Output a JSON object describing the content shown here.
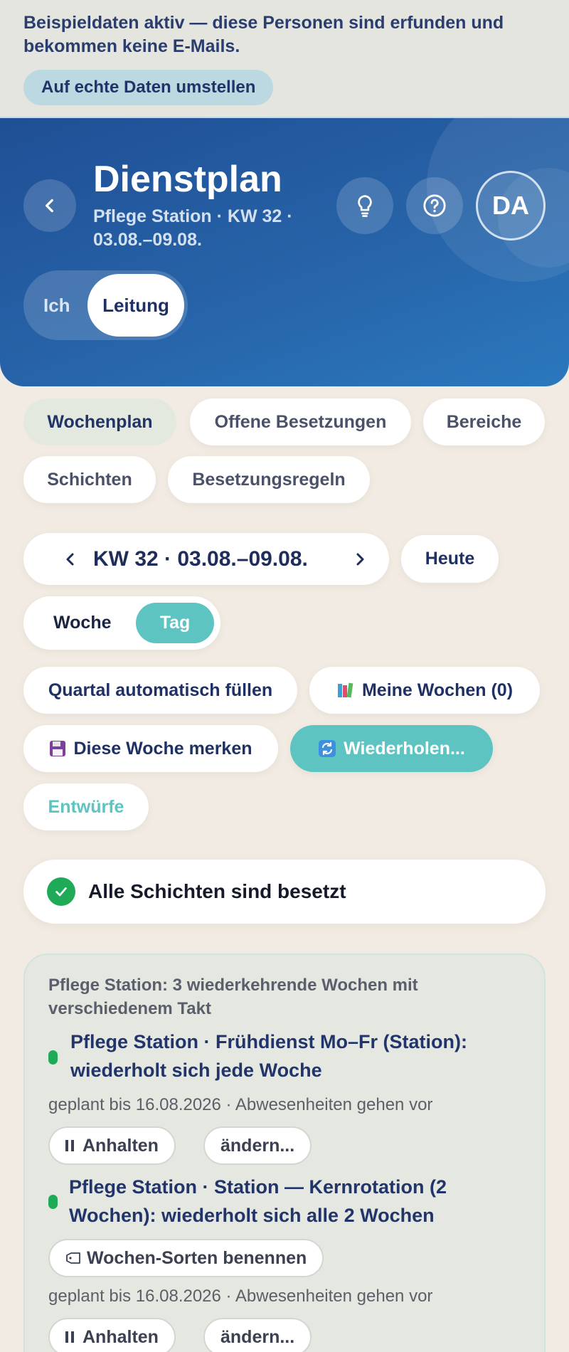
{
  "demo_banner": {
    "text": "Beispieldaten aktiv — diese Personen sind erfunden und bekommen keine E-Mails.",
    "button": "Auf echte Daten umstellen"
  },
  "header": {
    "title": "Dienstplan",
    "subtitle": "Pflege Station · KW 32 · 03.08.–09.08.",
    "avatar_initials": "DA",
    "role_toggle": {
      "ich": "Ich",
      "leitung": "Leitung",
      "selected": "Leitung"
    }
  },
  "tabs": [
    {
      "label": "Wochenplan",
      "active": true
    },
    {
      "label": "Offene Besetzungen",
      "active": false
    },
    {
      "label": "Bereiche",
      "active": false
    },
    {
      "label": "Schichten",
      "active": false
    },
    {
      "label": "Besetzungsregeln",
      "active": false
    }
  ],
  "week_nav": {
    "label": "KW 32 · 03.08.–09.08.",
    "today": "Heute"
  },
  "view_toggle": {
    "woche": "Woche",
    "tag": "Tag",
    "selected": "Tag"
  },
  "actions": {
    "quartal": "Quartal automatisch füllen",
    "meine_wochen": "Meine Wochen (0)",
    "merken": "Diese Woche merken",
    "wiederholen": "Wiederholen...",
    "entwuerfe": "Entwürfe"
  },
  "status": {
    "text": "Alle Schichten sind besetzt"
  },
  "recurring": {
    "heading": "Pflege Station: 3 wiederkehrende Wochen mit verschiedenem Takt",
    "items": [
      {
        "title": "Pflege Station · Frühdienst Mo–Fr (Station): wiederholt sich jede Woche",
        "meta": "geplant bis 16.08.2026 · Abwesenheiten gehen vor",
        "pause": "Anhalten",
        "edit": "ändern..."
      },
      {
        "title": "Pflege Station · Station — Kernrotation (2 Wochen): wiederholt sich alle 2 Wochen",
        "label_button": "Wochen-Sorten benennen",
        "meta": "geplant bis 16.08.2026 · Abwesenheiten gehen vor",
        "pause": "Anhalten",
        "edit": "ändern..."
      }
    ]
  },
  "colors": {
    "header_gradient_start": "#1f4f95",
    "header_gradient_end": "#2b78bd",
    "accent_teal": "#5ec4c2",
    "success_green": "#1eaa56",
    "background": "#f1ebe3"
  }
}
